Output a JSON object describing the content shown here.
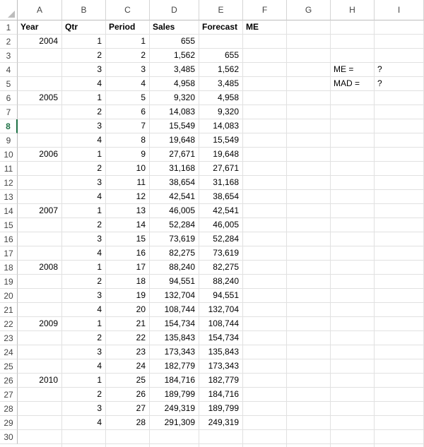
{
  "column_headers": [
    "A",
    "B",
    "C",
    "D",
    "E",
    "F",
    "G",
    "H",
    "I"
  ],
  "row_headers": [
    "1",
    "2",
    "3",
    "4",
    "5",
    "6",
    "7",
    "8",
    "9",
    "10",
    "11",
    "12",
    "13",
    "14",
    "15",
    "16",
    "17",
    "18",
    "19",
    "20",
    "21",
    "22",
    "23",
    "24",
    "25",
    "26",
    "27",
    "28",
    "29",
    "30"
  ],
  "selected_row": "8",
  "table_headers": {
    "year": "Year",
    "qtr": "Qtr",
    "period": "Period",
    "sales": "Sales",
    "forecast": "Forecast",
    "me": "ME"
  },
  "data_rows": [
    {
      "year": "2004",
      "qtr": "1",
      "period": "1",
      "sales": "655",
      "forecast": ""
    },
    {
      "year": "",
      "qtr": "2",
      "period": "2",
      "sales": "1,562",
      "forecast": "655"
    },
    {
      "year": "",
      "qtr": "3",
      "period": "3",
      "sales": "3,485",
      "forecast": "1,562"
    },
    {
      "year": "",
      "qtr": "4",
      "period": "4",
      "sales": "4,958",
      "forecast": "3,485"
    },
    {
      "year": "2005",
      "qtr": "1",
      "period": "5",
      "sales": "9,320",
      "forecast": "4,958"
    },
    {
      "year": "",
      "qtr": "2",
      "period": "6",
      "sales": "14,083",
      "forecast": "9,320"
    },
    {
      "year": "",
      "qtr": "3",
      "period": "7",
      "sales": "15,549",
      "forecast": "14,083"
    },
    {
      "year": "",
      "qtr": "4",
      "period": "8",
      "sales": "19,648",
      "forecast": "15,549"
    },
    {
      "year": "2006",
      "qtr": "1",
      "period": "9",
      "sales": "27,671",
      "forecast": "19,648"
    },
    {
      "year": "",
      "qtr": "2",
      "period": "10",
      "sales": "31,168",
      "forecast": "27,671"
    },
    {
      "year": "",
      "qtr": "3",
      "period": "11",
      "sales": "38,654",
      "forecast": "31,168"
    },
    {
      "year": "",
      "qtr": "4",
      "period": "12",
      "sales": "42,541",
      "forecast": "38,654"
    },
    {
      "year": "2007",
      "qtr": "1",
      "period": "13",
      "sales": "46,005",
      "forecast": "42,541"
    },
    {
      "year": "",
      "qtr": "2",
      "period": "14",
      "sales": "52,284",
      "forecast": "46,005"
    },
    {
      "year": "",
      "qtr": "3",
      "period": "15",
      "sales": "73,619",
      "forecast": "52,284"
    },
    {
      "year": "",
      "qtr": "4",
      "period": "16",
      "sales": "82,275",
      "forecast": "73,619"
    },
    {
      "year": "2008",
      "qtr": "1",
      "period": "17",
      "sales": "88,240",
      "forecast": "82,275"
    },
    {
      "year": "",
      "qtr": "2",
      "period": "18",
      "sales": "94,551",
      "forecast": "88,240"
    },
    {
      "year": "",
      "qtr": "3",
      "period": "19",
      "sales": "132,704",
      "forecast": "94,551"
    },
    {
      "year": "",
      "qtr": "4",
      "period": "20",
      "sales": "108,744",
      "forecast": "132,704"
    },
    {
      "year": "2009",
      "qtr": "1",
      "period": "21",
      "sales": "154,734",
      "forecast": "108,744"
    },
    {
      "year": "",
      "qtr": "2",
      "period": "22",
      "sales": "135,843",
      "forecast": "154,734"
    },
    {
      "year": "",
      "qtr": "3",
      "period": "23",
      "sales": "173,343",
      "forecast": "135,843"
    },
    {
      "year": "",
      "qtr": "4",
      "period": "24",
      "sales": "182,779",
      "forecast": "173,343"
    },
    {
      "year": "2010",
      "qtr": "1",
      "period": "25",
      "sales": "184,716",
      "forecast": "182,779"
    },
    {
      "year": "",
      "qtr": "2",
      "period": "26",
      "sales": "189,799",
      "forecast": "184,716"
    },
    {
      "year": "",
      "qtr": "3",
      "period": "27",
      "sales": "249,319",
      "forecast": "189,799"
    },
    {
      "year": "",
      "qtr": "4",
      "period": "28",
      "sales": "291,309",
      "forecast": "249,319"
    }
  ],
  "side_labels": [
    {
      "label": "ME =",
      "value": "?"
    },
    {
      "label": "MAD =",
      "value": "?"
    }
  ],
  "colors": {
    "gridline": "#e1e1e1",
    "header_text": "#444444",
    "selected_row_accent": "#1e7145"
  }
}
